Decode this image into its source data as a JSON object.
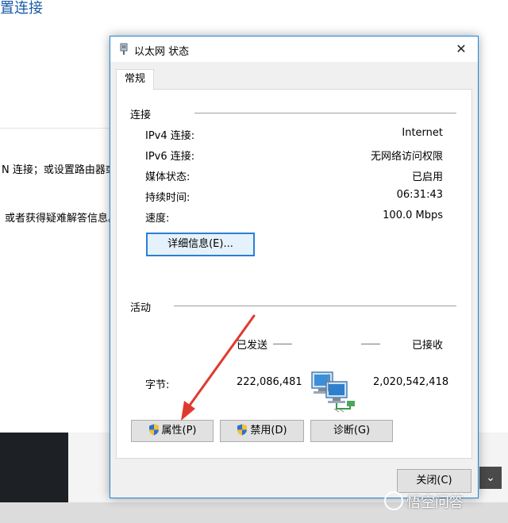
{
  "background": {
    "title": "置连接",
    "line1": "N 连接；或设置路由器或",
    "line2": "或者获得疑难解答信息。",
    "chevron": "⌄"
  },
  "watermark": "悟空问答",
  "dialog": {
    "title": "以太网 状态",
    "close_glyph": "✕",
    "tab": "常规",
    "connection": {
      "heading": "连接",
      "rows": [
        {
          "label": "IPv4 连接:",
          "value": "Internet"
        },
        {
          "label": "IPv6 连接:",
          "value": "无网络访问权限"
        },
        {
          "label": "媒体状态:",
          "value": "已启用"
        },
        {
          "label": "持续时间:",
          "value": "06:31:43"
        },
        {
          "label": "速度:",
          "value": "100.0 Mbps"
        }
      ],
      "details_button": "详细信息(E)..."
    },
    "activity": {
      "heading": "活动",
      "sent_label": "已发送",
      "received_label": "已接收",
      "bytes_label": "字节:",
      "bytes_sent": "222,086,481",
      "bytes_received": "2,020,542,418"
    },
    "buttons": {
      "properties": "属性(P)",
      "disable": "禁用(D)",
      "diagnose": "诊断(G)",
      "close": "关闭(C)"
    }
  },
  "icons": [
    "network-adapter-icon",
    "close-icon",
    "shield-icon",
    "network-computers-icon",
    "chevron-down-icon"
  ],
  "colors": {
    "accent": "#1e86d6",
    "arrow": "#e03a2e",
    "title_blue": "#1a5aa6"
  }
}
